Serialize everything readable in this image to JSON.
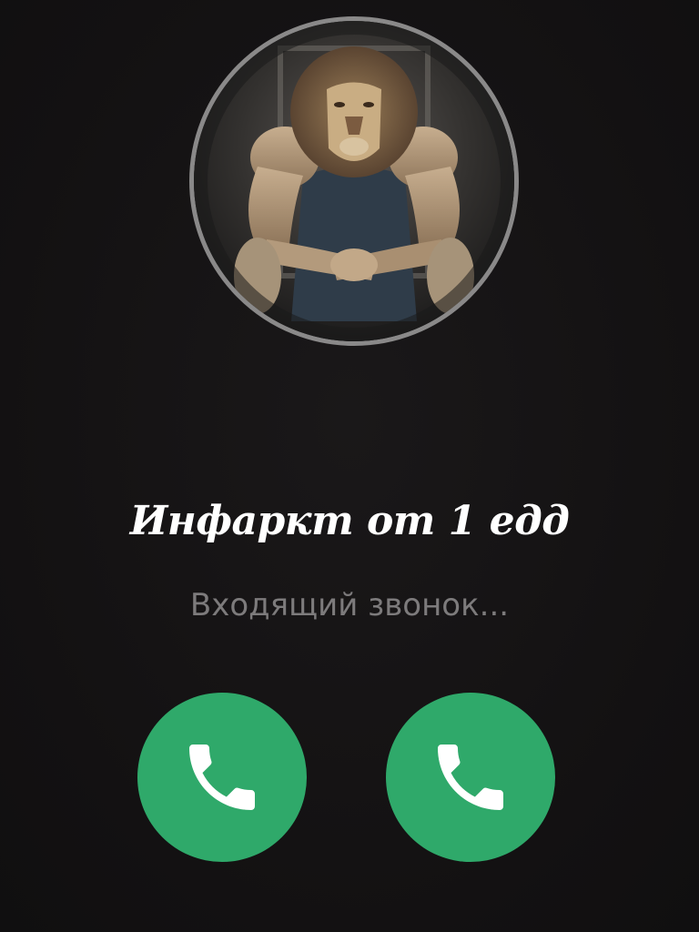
{
  "call": {
    "caller_name": "Инфаркт от 1 едд",
    "status": "Входящий звонок..."
  },
  "avatar": {
    "description_icon": "lion-bodybuilder-avatar"
  },
  "buttons": {
    "left": {
      "icon": "phone-icon"
    },
    "right": {
      "icon": "phone-icon"
    }
  },
  "colors": {
    "background": "#141213",
    "accept_button": "#2fa96a",
    "avatar_ring": "#8a8989",
    "status_text": "#7d7b7c",
    "name_text": "#ffffff"
  }
}
